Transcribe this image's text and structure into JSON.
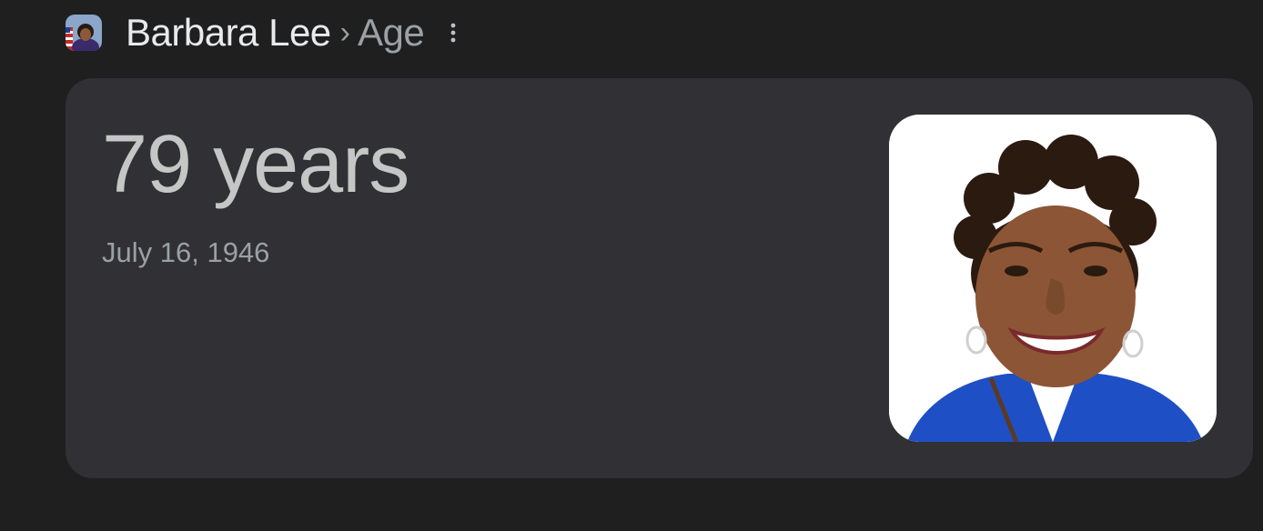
{
  "breadcrumb": {
    "entity": "Barbara Lee",
    "separator": "›",
    "attribute": "Age"
  },
  "icons": {
    "thumbnail": "entity-thumbnail-icon",
    "more": "more-vert-icon"
  },
  "answer": {
    "age": "79 years",
    "birth_date": "July 16, 1946"
  },
  "colors": {
    "background": "#1f1f1f",
    "card": "#303035",
    "primary_text": "#e8eaed",
    "secondary_text": "#9aa0a6"
  }
}
